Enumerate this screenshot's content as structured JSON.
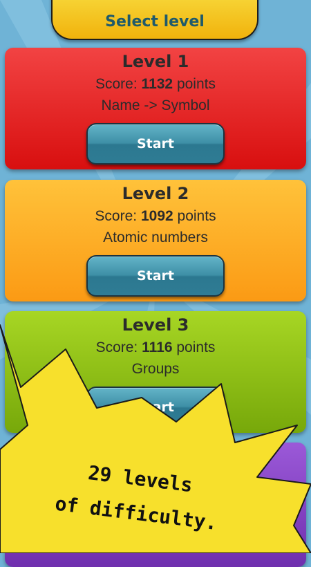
{
  "header": {
    "title": "Select level"
  },
  "levels": [
    {
      "title": "Level 1",
      "score_label": "Score:",
      "score_value": "1132",
      "score_unit": "points",
      "mode": "Name -> Symbol",
      "button_label": "Start",
      "color": "#e52a2a"
    },
    {
      "title": "Level 2",
      "score_label": "Score:",
      "score_value": "1092",
      "score_unit": "points",
      "mode": "Atomic numbers",
      "button_label": "Start",
      "color": "#fdae27"
    },
    {
      "title": "Level 3",
      "score_label": "Score:",
      "score_value": "1116",
      "score_unit": "points",
      "mode": "Groups",
      "button_label": "Start",
      "color": "#8fc017"
    },
    {
      "color": "#8544c3"
    }
  ],
  "promo": {
    "line1": "29 levels",
    "line2": "of difficulty.",
    "color": "#f7e02c"
  },
  "colors": {
    "background": "#6fb3d6",
    "header": "#f5c41f",
    "header_text": "#1f5a6b",
    "button": "#3e8fa6"
  }
}
